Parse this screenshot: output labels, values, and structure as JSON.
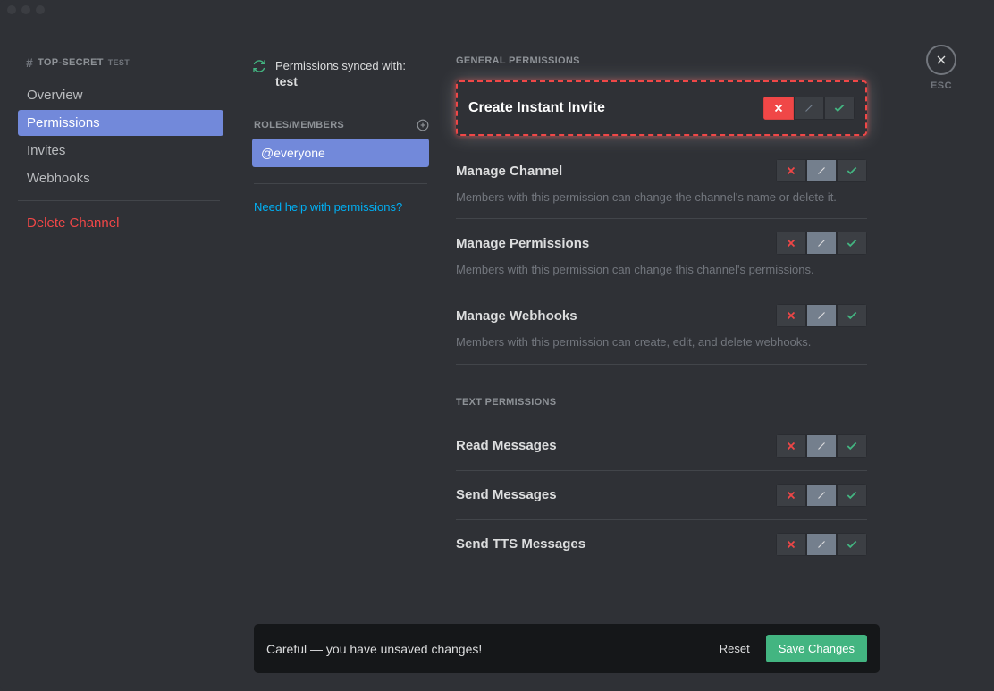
{
  "breadcrumb": {
    "channel": "TOP-SECRET",
    "suffix": "TEST"
  },
  "sidebar": {
    "items": [
      "Overview",
      "Permissions",
      "Invites",
      "Webhooks"
    ],
    "active": 1,
    "delete": "Delete Channel"
  },
  "sync": {
    "label": "Permissions synced with:",
    "target": "test"
  },
  "roles": {
    "header": "ROLES/MEMBERS",
    "items": [
      "@everyone"
    ]
  },
  "help": "Need help with permissions?",
  "close": "ESC",
  "sections": [
    {
      "title": "GENERAL PERMISSIONS",
      "perms": [
        {
          "label": "Create Instant Invite",
          "desc": "",
          "state": "deny",
          "highlight": true
        },
        {
          "label": "Manage Channel",
          "desc": "Members with this permission can change the channel's name or delete it.",
          "state": "neutral"
        },
        {
          "label": "Manage Permissions",
          "desc": "Members with this permission can change this channel's permissions.",
          "state": "neutral"
        },
        {
          "label": "Manage Webhooks",
          "desc": "Members with this permission can create, edit, and delete webhooks.",
          "state": "neutral"
        }
      ]
    },
    {
      "title": "TEXT PERMISSIONS",
      "perms": [
        {
          "label": "Read Messages",
          "desc": "",
          "state": "neutral"
        },
        {
          "label": "Send Messages",
          "desc": "",
          "state": "neutral"
        },
        {
          "label": "Send TTS Messages",
          "desc": "",
          "state": "neutral"
        }
      ]
    }
  ],
  "toast": {
    "message": "Careful — you have unsaved changes!",
    "reset": "Reset",
    "save": "Save Changes"
  }
}
